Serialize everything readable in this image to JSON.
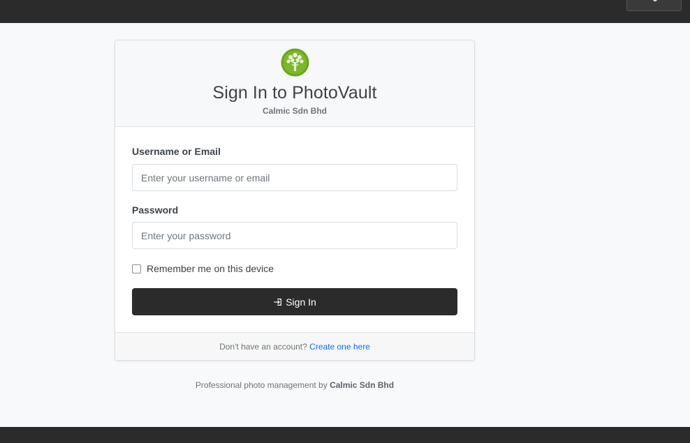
{
  "header": {},
  "login": {
    "title": "Sign In to PhotoVault",
    "company": "Calmic Sdn Bhd",
    "username_label": "Username or Email",
    "username_placeholder": "Enter your username or email",
    "username_value": "",
    "password_label": "Password",
    "password_placeholder": "Enter your password",
    "password_value": "",
    "remember_label": "Remember me on this device",
    "remember_checked": false,
    "submit_label": "Sign In",
    "submit_icon": "sign-in-icon",
    "logo_icon": "tree-logo-icon"
  },
  "signup": {
    "prompt": "Don't have an account?",
    "link_text": "Create one here"
  },
  "footer": {
    "tagline": "Professional photo management by",
    "company": "Calmic Sdn Bhd"
  },
  "colors": {
    "navbar": "#2b2b2b",
    "button": "#2b2b2b",
    "link": "#0d6efd",
    "logo_green": "#6aa51e",
    "background": "#f8f9fa"
  }
}
